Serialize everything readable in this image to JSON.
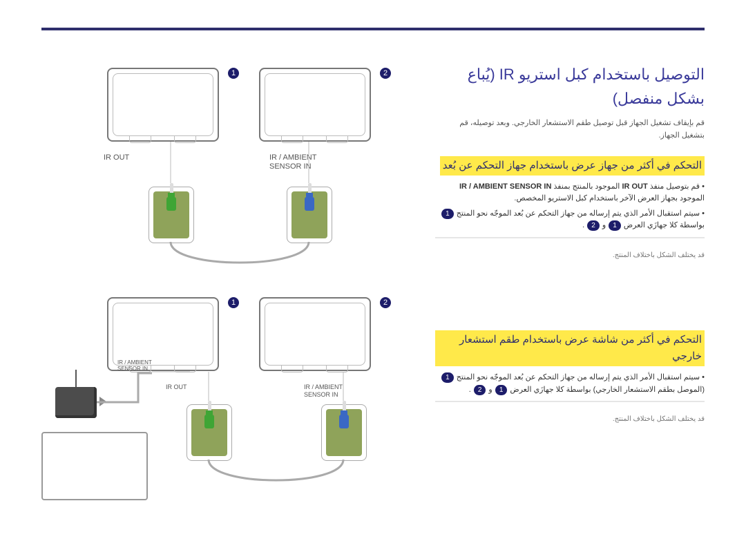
{
  "title": "التوصيل باستخدام كبل استريو IR (يُباع بشكل منفصل)",
  "subtitle": "قم بإيقاف تشغيل الجهاز قبل توصيل طقم الاستشعار الخارجي. وبعد توصيله، قم بتشغيل الجهاز.",
  "section1": {
    "heading": "التحكم في أكثر من جهاز عرض باستخدام جهاز التحكم عن بُعد",
    "b1_a": "قم بتوصيل منفذ ",
    "b1_b": " الموجود بالمنتج بمنفذ ",
    "b1_c": " الموجود بجهاز العرض الآخر باستخدام كبل الاستريو المخصص.",
    "b1_bold1": "IR OUT",
    "b1_bold2": "IR / AMBIENT SENSOR IN",
    "b2_a": "سيتم استقبال الأمر الذي يتم إرساله من جهاز التحكم عن بُعد الموجّه نحو المنتج ",
    "b2_b": " بواسطة كلا جهازَي العرض ",
    "b2_c": " و ",
    "b2_d": ".",
    "note": "قد يختلف الشكل باختلاف المنتج."
  },
  "section2": {
    "heading": "التحكم في أكثر من شاشة عرض باستخدام طقم استشعار خارجي",
    "b1_a": "سيتم استقبال الأمر الذي يتم إرساله من جهاز التحكم عن بُعد الموجّه نحو المنتج ",
    "b1_b": " (الموصل بطقم الاستشعار الخارجي) بواسطة كلا جهازَي العرض ",
    "b1_c": " و ",
    "b1_d": ".",
    "note": "قد يختلف الشكل باختلاف المنتج."
  },
  "labels": {
    "irout": "IR OUT",
    "irambient": "IR / AMBIENT",
    "sensorin": "SENSOR IN",
    "n1": "1",
    "n2": "2"
  }
}
